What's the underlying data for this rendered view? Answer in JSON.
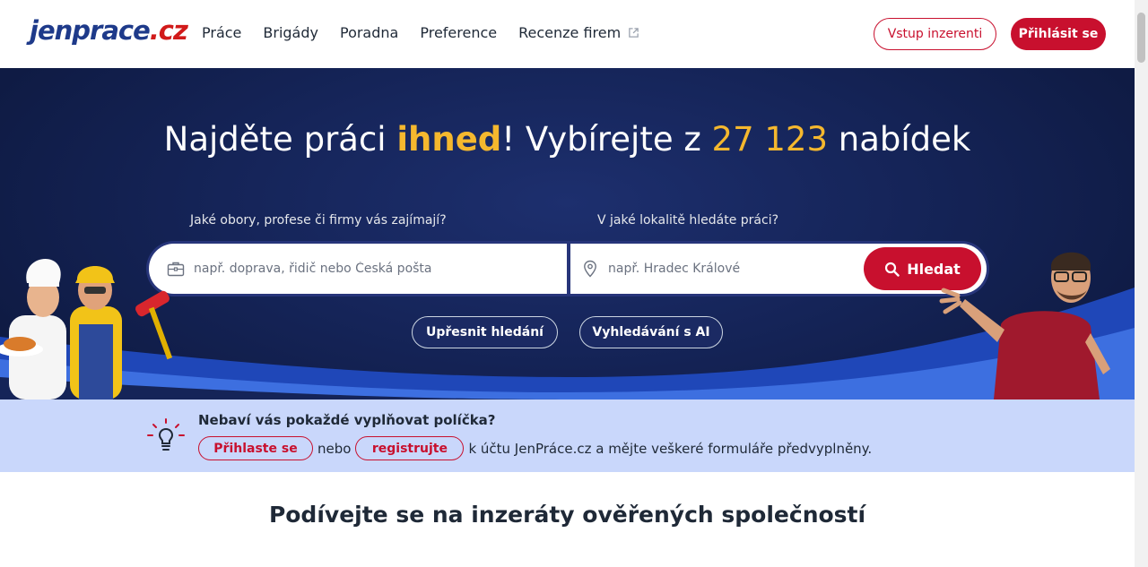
{
  "header": {
    "logo_main": "jenprace",
    "logo_tld": ".cz",
    "nav": [
      {
        "label": "Práce"
      },
      {
        "label": "Brigády"
      },
      {
        "label": "Poradna"
      },
      {
        "label": "Preference"
      },
      {
        "label": "Recenze firem",
        "icon": "external-link-icon"
      }
    ],
    "employer_button": "Vstup inzerenti",
    "login_button": "Přihlásit se"
  },
  "hero": {
    "title_part1": "Najděte práci ",
    "title_highlight": "ihned",
    "title_part2": "! Vybírejte z ",
    "title_count": "27 123",
    "title_part3": " nabídek",
    "what_label": "Jaké obory, profese či firmy vás zajímají?",
    "where_label": "V jaké lokalitě hledáte práci?",
    "what_placeholder": "např. doprava, řidič nebo Česká pošta",
    "where_placeholder": "např. Hradec Králové",
    "search_button": "Hledat",
    "refine_button": "Upřesnit hledání",
    "ai_button": "Vyhledávání s AI"
  },
  "notice": {
    "title": "Nebaví vás pokaždé vyplňovat políčka?",
    "login_link": "Přihlaste se",
    "connector": "nebo",
    "register_link": "registrujte",
    "rest": "k účtu JenPráce.cz a mějte veškeré formuláře předvyplněny."
  },
  "section": {
    "title": "Podívejte se na inzeráty ověřených společností"
  },
  "colors": {
    "brand_red": "#c8102e",
    "brand_blue": "#1e3a8a",
    "hero_bg": "#152458",
    "accent_yellow": "#f5b82e",
    "notice_bg": "#c9d7fb"
  }
}
